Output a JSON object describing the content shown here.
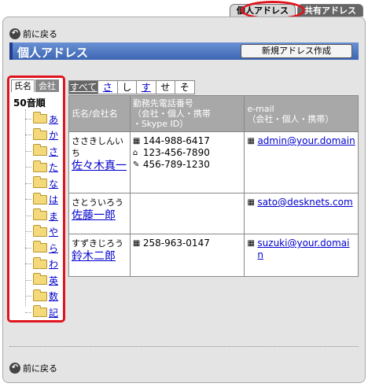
{
  "top_tabs": [
    {
      "label": "個人アドレス",
      "active": true
    },
    {
      "label": "共有アドレス",
      "active": false
    }
  ],
  "back_label": "前に戻る",
  "page_title": "個人アドレス",
  "new_address_button": "新規アドレス作成",
  "left_tabs": [
    {
      "label": "氏名",
      "active": true
    },
    {
      "label": "会社",
      "active": false
    }
  ],
  "tree": {
    "root": "50音順",
    "items": [
      "あ",
      "か",
      "さ",
      "た",
      "な",
      "は",
      "ま",
      "や",
      "ら",
      "わ",
      "英",
      "数",
      "記"
    ]
  },
  "kana_tabs": [
    {
      "label": "すべて",
      "active": true
    },
    {
      "label": "さ",
      "active": false,
      "link": true
    },
    {
      "label": "し",
      "active": false,
      "link": false
    },
    {
      "label": "す",
      "active": false,
      "link": true
    },
    {
      "label": "せ",
      "active": false,
      "link": false
    },
    {
      "label": "そ",
      "active": false,
      "link": false
    }
  ],
  "table": {
    "headers": {
      "name": "氏名/会社名",
      "phone": "勤務先電話番号\n（会社・個人・携帯\n・Skype ID）",
      "email": "e-mail\n（会社・個人・携帯）"
    },
    "rows": [
      {
        "kana": "ささきしんいち",
        "name": "佐々木真一",
        "phones": [
          {
            "icon": "building-icon",
            "value": "144-988-6417"
          },
          {
            "icon": "home-icon",
            "value": "123-456-7890"
          },
          {
            "icon": "mobile-icon",
            "value": "456-789-1230"
          }
        ],
        "email": "admin@your.domain"
      },
      {
        "kana": "さとういろう",
        "name": "佐藤一郎",
        "phones": [],
        "email": "sato@desknets.com"
      },
      {
        "kana": "すずきじろう",
        "name": "鈴木二郎",
        "phones": [
          {
            "icon": "building-icon",
            "value": "258-963-0147"
          }
        ],
        "email": "suzuki@your.domain"
      }
    ]
  },
  "colors": {
    "title_bar": "#3c66b4",
    "highlight": "#e0141e",
    "link": "#0000cc"
  }
}
